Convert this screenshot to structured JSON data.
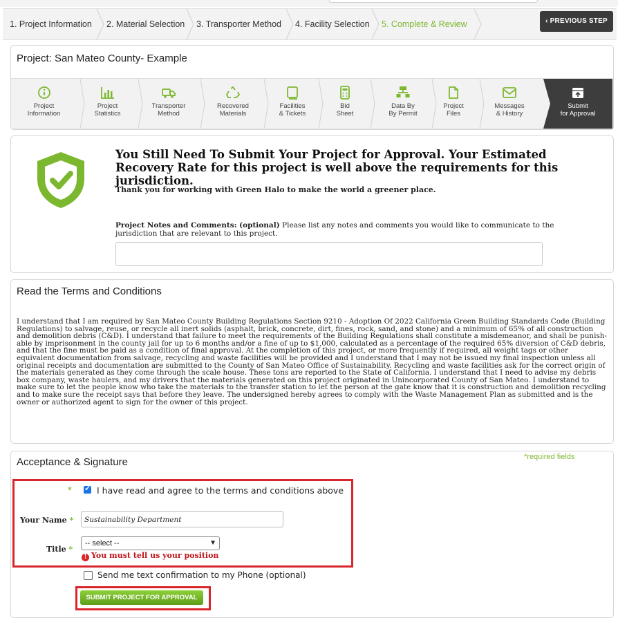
{
  "steps": [
    {
      "label": "1. Project Information",
      "active": false
    },
    {
      "label": "2. Material Selection",
      "active": false
    },
    {
      "label": "3. Transporter Method",
      "active": false
    },
    {
      "label": "4. Facility Selection",
      "active": false
    },
    {
      "label": "5. Complete & Review",
      "active": true
    }
  ],
  "prev_button": "‹ PREVIOUS STEP",
  "project_title": "Project:  San Mateo County- Example",
  "toolbar": [
    {
      "l1": "Project",
      "l2": "Information",
      "icon": "info-icon"
    },
    {
      "l1": "Project",
      "l2": "Statistics",
      "icon": "bar-chart-icon"
    },
    {
      "l1": "Transporter",
      "l2": "Method",
      "icon": "truck-icon"
    },
    {
      "l1": "Recovered",
      "l2": "Materials",
      "icon": "recycle-icon"
    },
    {
      "l1": "Facilities",
      "l2": "& Tickets",
      "icon": "facility-icon"
    },
    {
      "l1": "Bid",
      "l2": "Sheet",
      "icon": "calculator-icon"
    },
    {
      "l1": "Data By",
      "l2": "By Permit",
      "icon": "network-icon"
    },
    {
      "l1": "Project",
      "l2": "Files",
      "icon": "files-icon"
    },
    {
      "l1": "Messages",
      "l2": "& History",
      "icon": "envelope-icon"
    },
    {
      "l1": "Submit",
      "l2": "for Approval",
      "icon": "upload-icon"
    }
  ],
  "status": {
    "headline": "You Still Need To Submit Your Project for Approval. Your Estimated Recovery Rate for this project is well above the requirements for this jurisdiction.",
    "thanks": "Thank you for working with Green Halo to make the world a greener place.",
    "notes_label_bold": "Project Notes and Comments: (optional)",
    "notes_label_rest": " Please list any notes and comments you would like to communicate to the jurisdiction that are relevant to this project.",
    "notes_value": ""
  },
  "terms": {
    "title": "Read the Terms and Conditions",
    "body": "I understand that I am required by San Mateo County Building Regulations Section 9210 - Adoption Of 2022 California Green Building Standards Code (Building Regulations) to salvage, reuse, or recycle all inert solids (asphalt, brick, concrete, dirt, fines, rock, sand, and stone) and a minimum of 65% of all construction and demolition debris (C&D). I understand that failure to meet the requirements of the Building Regulations shall constitute a misdemeanor, and shall be punish-able by imprisonment in the county jail for up to 6 months and/or a fine of up to $1,000, calculated as a percentage of the required 65% diversion of C&D debris, and that the fine must be paid as a condition of final approval. At the completion of this project, or more frequently if required, all weight tags or other equivalent documentation from salvage, recycling and waste facilities will be provided and I understand that I may not be issued my final inspection unless all original receipts and documentation are submitted to the County of San Mateo Office of Sustainability. Recycling and waste facilities ask for the correct origin of the materials generated as they come through the scale house. These tons are reported to the State of California. I understand that I need to advise my debris box company, waste haulers, and my drivers that the materials generated on this project originated in Unincorporated County of San Mateo. I understand to make sure to let the people know who take the materials to the transfer station to let the person at the gate know that it is construction and demolition recycling and to make sure the receipt says that before they leave. The undersigned hereby agrees to comply with the Waste Management Plan as submitted and is the owner or authorized agent to sign for the owner of this project."
  },
  "acceptance": {
    "title": "Acceptance & Signature",
    "required_note": "*required fields",
    "agree_label": "I have read and agree to the terms and conditions above",
    "agree_checked": true,
    "name_label": "Your Name",
    "name_value": "Sustainability Department",
    "title_label": "Title",
    "title_select_value": "-- select --",
    "title_error": "You must tell us your position",
    "sms_label": "Send me text confirmation to my Phone (optional)",
    "sms_checked": false,
    "submit_label": "SUBMIT PROJECT FOR APPROVAL"
  },
  "colors": {
    "accent": "#7cb82f",
    "dark": "#3d3d3d",
    "error": "#d9262b"
  }
}
